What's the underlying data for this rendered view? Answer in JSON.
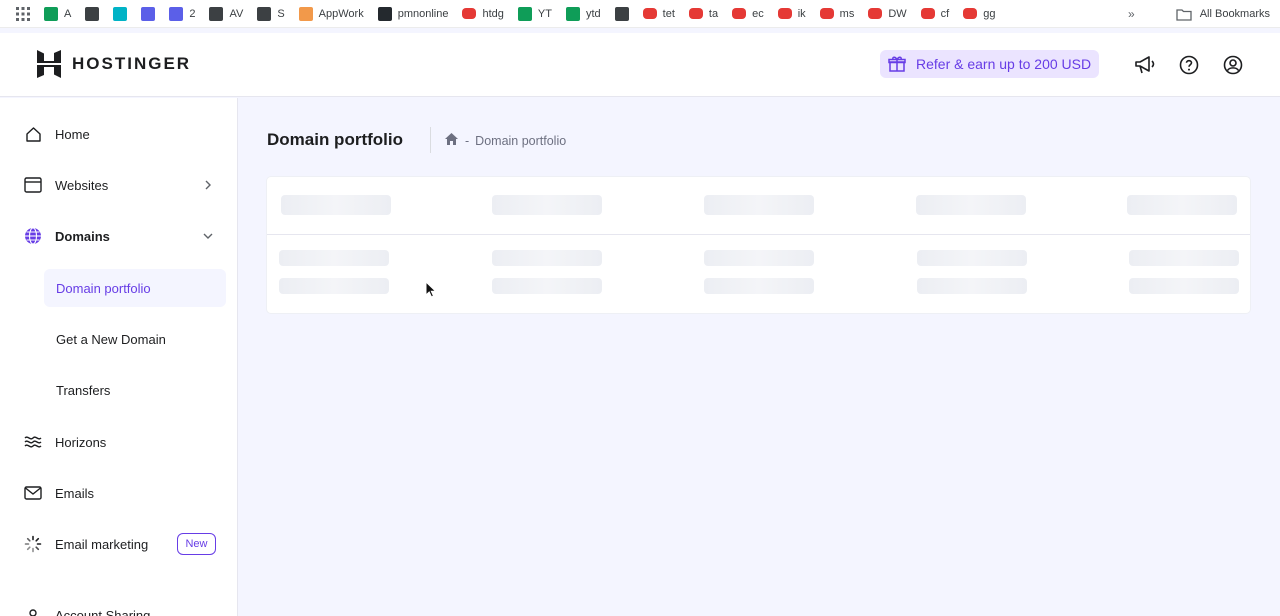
{
  "bookmarks": {
    "items": [
      {
        "label": "A",
        "color": "#0f9d58"
      },
      {
        "label": "",
        "color": "#3c4043"
      },
      {
        "label": "",
        "color": "#00b3c6"
      },
      {
        "label": "",
        "color": "#5b5fe8"
      },
      {
        "label": "2",
        "color": "#5b5fe8"
      },
      {
        "label": "AV",
        "color": "#3c4043"
      },
      {
        "label": "S",
        "color": "#3c4043"
      },
      {
        "label": "AppWork",
        "color": "#f2994a"
      },
      {
        "label": "pmnonline",
        "color": "#24292e"
      },
      {
        "label": "htdg",
        "color": "#e53935"
      },
      {
        "label": "YT",
        "color": "#0f9d58"
      },
      {
        "label": "ytd",
        "color": "#0f9d58"
      },
      {
        "label": "",
        "color": "#3c4043"
      },
      {
        "label": "tet",
        "color": "#e53935"
      },
      {
        "label": "ta",
        "color": "#e53935"
      },
      {
        "label": "ec",
        "color": "#e53935"
      },
      {
        "label": "ik",
        "color": "#e53935"
      },
      {
        "label": "ms",
        "color": "#e53935"
      },
      {
        "label": "DW",
        "color": "#e53935"
      },
      {
        "label": "cf",
        "color": "#e53935"
      },
      {
        "label": "gg",
        "color": "#e53935"
      }
    ],
    "more": "»",
    "all_bookmarks": "All Bookmarks"
  },
  "header": {
    "logo_text": "HOSTINGER",
    "refer": "Refer & earn up to 200 USD",
    "accent": "#673de6"
  },
  "sidebar": {
    "home": "Home",
    "websites": "Websites",
    "domains": "Domains",
    "sub": {
      "portfolio": "Domain portfolio",
      "new_domain": "Get a New Domain",
      "transfers": "Transfers"
    },
    "horizons": "Horizons",
    "emails": "Emails",
    "email_marketing": "Email marketing",
    "new_badge": "New",
    "account_sharing": "Account Sharing"
  },
  "main": {
    "title": "Domain portfolio",
    "breadcrumb_sep": "-",
    "breadcrumb": "Domain portfolio"
  }
}
